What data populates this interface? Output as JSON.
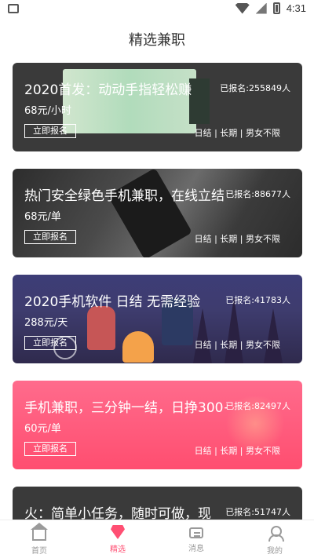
{
  "status_bar": {
    "time": "4:31"
  },
  "header": {
    "title": "精选兼职"
  },
  "cards": [
    {
      "title": "2020首发：动动手指轻松赚",
      "count": "已报名:255849人",
      "price": "68元/小时",
      "signup": "立即报名",
      "tags": "日结 | 长期 | 男女不限"
    },
    {
      "title": "热门安全绿色手机兼职，在线立结",
      "count": "已报名:88677人",
      "price": "68元/单",
      "signup": "立即报名",
      "tags": "日结 | 长期 | 男女不限"
    },
    {
      "title": "2020手机软件 日结 无需经验",
      "count": "已报名:41783人",
      "price": "288元/天",
      "signup": "立即报名",
      "tags": "日结 | 长期 | 男女不限"
    },
    {
      "title": "手机兼职，三分钟一结，日挣300+",
      "count": "已报名:82497人",
      "price": "60元/单",
      "signup": "立即报名",
      "tags": "日结 | 长期 | 男女不限"
    },
    {
      "title": "火：简单小任务，随时可做，现",
      "count": "已报名:51747人"
    }
  ],
  "bottom_nav": [
    {
      "label": "首页"
    },
    {
      "label": "精选"
    },
    {
      "label": "消息"
    },
    {
      "label": "我的"
    }
  ],
  "colors": {
    "accent": "#ff4f73",
    "card4_gradient": [
      "#ff6b8c",
      "#ff4e70"
    ]
  }
}
